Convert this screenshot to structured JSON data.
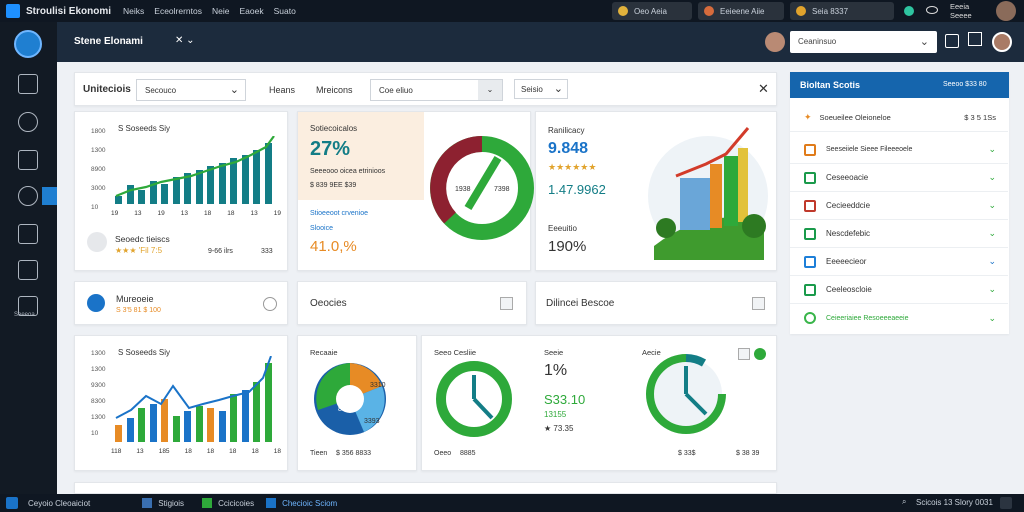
{
  "topbar": {
    "app_title": "Stroulisi Ekonomi",
    "menu": [
      "Neiks",
      "Eceolrerntos",
      "Neie",
      "Eaoek",
      "Suato"
    ],
    "chip1": "Oeo Aeia",
    "chip2": "Eeieene Aiie",
    "chip3": "Seia 8337",
    "user_line1": "Eeeia",
    "user_line2": "Seeee"
  },
  "header": {
    "title": "Stene Elonami",
    "dropdown_value": "Ceaninsuo"
  },
  "filter_bar": {
    "label": "Uniteciois",
    "select1": "Secouco",
    "link1": "Heans",
    "link2": "Mreicons",
    "search_placeholder": "Coe eliuo",
    "select2": "Seisio"
  },
  "card_bar1": {
    "label_value": "S Soseeds Siy",
    "y_ticks": [
      "1800",
      "1300",
      "8900",
      "3000",
      "10"
    ],
    "x_ticks": [
      "19",
      "13",
      "19",
      "13",
      "18",
      "18",
      "13",
      "19"
    ],
    "footer_title": "Seoedc tieiscs",
    "footer_stars": "★★★ 'Fil 7:5",
    "footer_mid": "9-66 ilrs",
    "footer_right": "333"
  },
  "card_kpi1": {
    "title": "Sotiecoicalos",
    "value": "27%",
    "sub": "Seeeooo oicea etrinioos",
    "sub2": "$ 839 9EE $39",
    "label2": "Stioeeoot crvenioe",
    "label3": "Slooice",
    "value2": "41.0,%"
  },
  "card_donut1": {
    "center_left": "1938",
    "center_right": "7398"
  },
  "card_kpi2": {
    "title": "Ranilicacy",
    "value": "9.848",
    "stars": "★★★★★★",
    "value2": "1.47.9962",
    "label": "Eeeuitio",
    "value3": "190%"
  },
  "row2": {
    "card1_title": "Mureoeie",
    "card1_sub": "S 3'5 81 $ 100",
    "card2_title": "Oeocies",
    "card3_title": "Dilincei Bescoe"
  },
  "card_bar2": {
    "label_value": "S Soseeds Siy",
    "y_ticks": [
      "1300",
      "1300",
      "9300",
      "8300",
      "1300",
      "10"
    ],
    "x_ticks": [
      "118",
      "13",
      "185",
      "18",
      "18",
      "18",
      "18",
      "18"
    ]
  },
  "card_pie": {
    "title": "Recaaie",
    "v1": "3310",
    "v2": "8961",
    "v3": "3393",
    "footer_l": "Tieen",
    "footer_r": "$ 356 8833"
  },
  "card_clocks": {
    "title": "Seeo Cesliie",
    "footer_l": "Oeeo",
    "footer_r": "8885",
    "kpi_title": "Seeie",
    "kpi_v1": "1%",
    "kpi_v2": "S33.10",
    "kpi_v3": "13155",
    "kpi_v4": "★ 73.35",
    "clock2_title": "Aecie",
    "footer_r2": "$ 33$",
    "footer_r3": "$ 38 39"
  },
  "right_panel": {
    "title": "Bioltan Scotis",
    "title_right": "Seeoo $33 80",
    "head_row": "Soeueilee Oleioneloe",
    "head_val": "$ 3 5 1Ss",
    "items": [
      "Seeseiiele Sieee Fileeeoele",
      "Ceseeoacie",
      "Cecieeddcie",
      "Nescdefebic",
      "Eeeeecieor",
      "Ceeleoscloie",
      "Ceieeriaiee Resoeeeaeeie"
    ],
    "item_colors": [
      "#e07b1a",
      "#1a9a4b",
      "#c0392b",
      "#1a9a4b",
      "#1e7fd8",
      "#1a9a4b",
      "#39b54a"
    ]
  },
  "status": {
    "s1": "Ceyoio Cleoaiciot",
    "s2": "Stigiois",
    "s3": "Ccicicoies",
    "s4": "Checioic Sciom",
    "s5": "Scicois 13 Slory 0031"
  },
  "colors": {
    "teal": "#137d86",
    "green": "#2ea93a",
    "darkred": "#8d2130",
    "blue": "#1a73c8",
    "orange": "#e78b25"
  }
}
